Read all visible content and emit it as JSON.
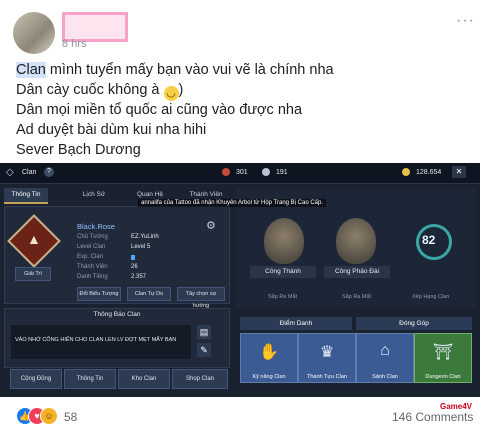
{
  "post": {
    "time": "8 hrs",
    "more": "···",
    "highlight": "Clan",
    "line1_rest": " mình tuyển mấy bạn vào vui vẽ là chính nha",
    "line2": "Dân cày cuốc không à ",
    "line2_end": ")",
    "line3": "Dân mọi miền tổ quốc ai cũng vào được nha",
    "line4": "Ad duyệt bài dùm kui nha hihi",
    "line5": "Sever Bạch Dương"
  },
  "game": {
    "header": {
      "title": "Clan",
      "help": "?",
      "stat1": "301",
      "stat2": "191",
      "stat3": "128.654"
    },
    "tabs": [
      "Thông Tin",
      "Lịch Sử",
      "Quan Hệ",
      "Thành Viên"
    ],
    "toast": "annalifa của Tattoo đã nhận Khuyên Arbol từ Hộp Trang Bị Cao Cấp.",
    "clan": {
      "name": "Black.Rose",
      "rows": [
        {
          "label": "Chủ Tướng",
          "value": "EZ.YuLinh"
        },
        {
          "label": "Level Clan",
          "value": "Level 5"
        },
        {
          "label": "Exp. Clan",
          "value": ""
        },
        {
          "label": "Thành Viên",
          "value": "26"
        },
        {
          "label": "Danh Tiếng",
          "value": "2.357"
        }
      ],
      "rank_label": "Giải Trí",
      "buttons": [
        "Đổi Biểu Tượng",
        "Clan Tự Do",
        "Tây chọn sự hướng"
      ]
    },
    "notice": {
      "title": "Thông Báo Clan",
      "text": "VÀO NHỚ CỐNG HIẾN CHO CLAN LEN LV ĐỢT MẸT MẤY BẠN"
    },
    "bottom_buttons": [
      "Cộng Đồng",
      "Thông Tin",
      "Kho Clan",
      "Shop Clan"
    ],
    "right": {
      "castle1": "Công Thành",
      "castle2": "Công Pháo Đài",
      "sub1": "Sắp Ra Mắt",
      "sub2": "Sắp Ra Mắt",
      "sub3": "Xếp Hạng Clan",
      "level": "82"
    },
    "actions": {
      "title1": "Điểm Danh",
      "title2": "Đóng Góp",
      "items": [
        "Kỹ năng Clan",
        "Thành Tựu Clan",
        "Sảnh Clan",
        "Dungeon Clan"
      ]
    }
  },
  "footer": {
    "reaction_count": "58",
    "comments": "146 Comments",
    "watermark": "Game4V"
  }
}
